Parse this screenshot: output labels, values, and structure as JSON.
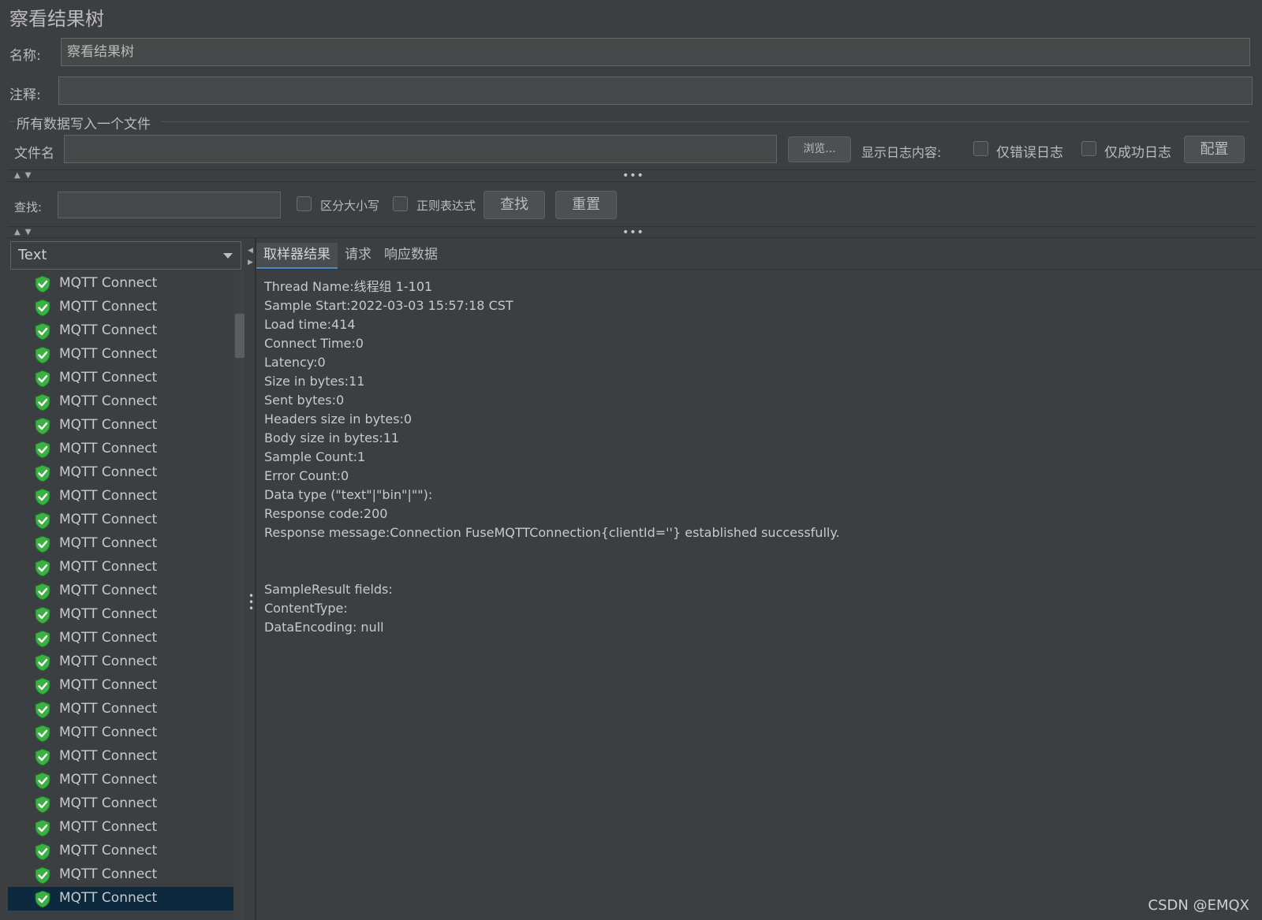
{
  "window": {
    "title": "察看结果树"
  },
  "form": {
    "name_label": "名称:",
    "name_value": "察看结果树",
    "comment_label": "注释:",
    "comment_value": ""
  },
  "file_group": {
    "legend": "所有数据写入一个文件",
    "filename_label": "文件名",
    "filename_value": "",
    "browse_label": "浏览...",
    "log_label": "显示日志内容:",
    "errors_only_label": "仅错误日志",
    "success_only_label": "仅成功日志",
    "configure_label": "配置"
  },
  "search": {
    "label": "查找:",
    "value": "",
    "case_label": "区分大小写",
    "regex_label": "正则表达式",
    "find_label": "查找",
    "reset_label": "重置"
  },
  "renderer": {
    "selected": "Text"
  },
  "tree": {
    "item_label": "MQTT Connect",
    "item_count": 27,
    "selected_index": 26,
    "icon": "shield-check-icon",
    "icon_color": "#3cb043"
  },
  "tabs": [
    {
      "label": "取样器结果",
      "active": true
    },
    {
      "label": "请求",
      "active": false
    },
    {
      "label": "响应数据",
      "active": false
    }
  ],
  "result_lines": [
    "Thread Name:线程组 1-101",
    "Sample Start:2022-03-03 15:57:18 CST",
    "Load time:414",
    "Connect Time:0",
    "Latency:0",
    "Size in bytes:11",
    "Sent bytes:0",
    "Headers size in bytes:0",
    "Body size in bytes:11",
    "Sample Count:1",
    "Error Count:0",
    "Data type (\"text\"|\"bin\"|\"\"):",
    "Response code:200",
    "Response message:Connection FuseMQTTConnection{clientId=''} established successfully.",
    "",
    "",
    "SampleResult fields:",
    "ContentType:",
    "DataEncoding: null"
  ],
  "watermark": "CSDN @EMQX",
  "colors": {
    "accent": "#4a88c7",
    "selection": "#0d293e",
    "background": "#3c3f41"
  }
}
